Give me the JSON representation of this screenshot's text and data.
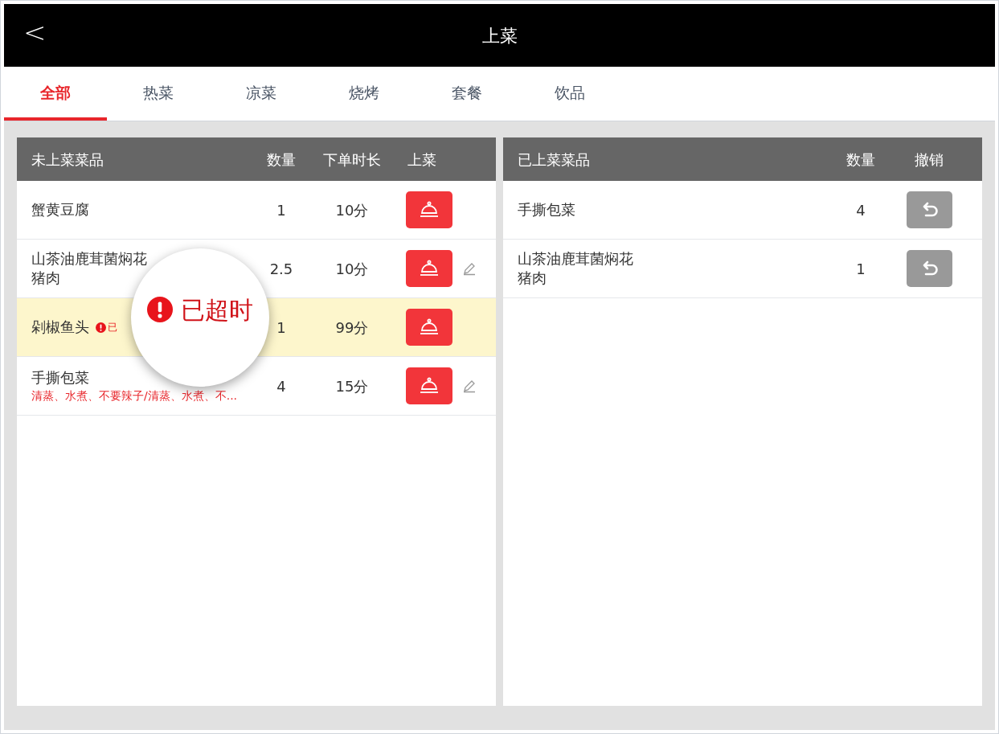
{
  "header": {
    "back": "<",
    "title": "上菜"
  },
  "tabs": [
    {
      "label": "全部",
      "selected": true
    },
    {
      "label": "热菜",
      "selected": false
    },
    {
      "label": "凉菜",
      "selected": false
    },
    {
      "label": "烧烤",
      "selected": false
    },
    {
      "label": "套餐",
      "selected": false
    },
    {
      "label": "饮品",
      "selected": false
    }
  ],
  "pending": {
    "columns": [
      "未上菜菜品",
      "数量",
      "下单时长",
      "上菜"
    ],
    "rows": [
      {
        "name": "蟹黄豆腐",
        "qty": "1",
        "duration": "10分",
        "overdue": false,
        "editable": false
      },
      {
        "name": "山茶油鹿茸菌焖花猪肉",
        "qty": "2.5",
        "duration": "10分",
        "overdue": false,
        "editable": true
      },
      {
        "name": "剁椒鱼头",
        "tag": "已",
        "qty": "1",
        "duration": "99分",
        "overdue": true,
        "editable": false
      },
      {
        "name": "手撕包菜",
        "note": "清蒸、水煮、不要辣子/清蒸、水煮、不...",
        "qty": "4",
        "duration": "15分",
        "overdue": false,
        "editable": true
      }
    ]
  },
  "served": {
    "columns": [
      "已上菜菜品",
      "数量",
      "撤销"
    ],
    "rows": [
      {
        "name": "手撕包菜",
        "qty": "4"
      },
      {
        "name": "山茶油鹿茸菌焖花猪肉",
        "qty": "1"
      }
    ]
  },
  "magnifier": {
    "text": "已超时"
  }
}
